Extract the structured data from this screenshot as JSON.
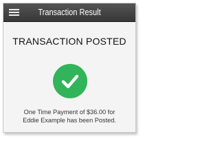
{
  "header": {
    "title": "Transaction Result",
    "menu_icon": "hamburger-menu-icon"
  },
  "main": {
    "heading": "TRANSACTION POSTED",
    "status_icon": "check-circle-icon",
    "status_color": "#31b45a",
    "message_line1": "One Time Payment of $36.00 for",
    "message_line2": "Eddie Example has been Posted."
  }
}
